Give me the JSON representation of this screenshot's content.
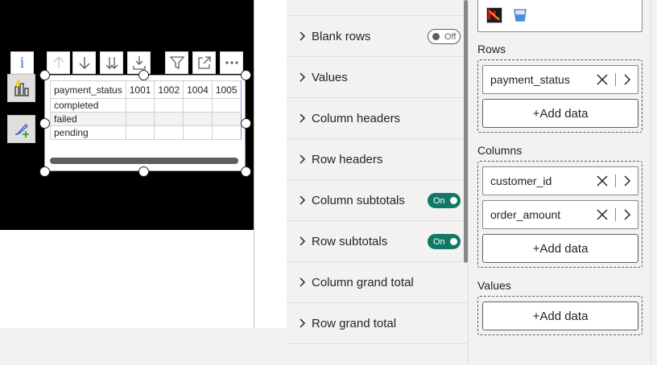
{
  "matrix": {
    "row_header_title": "payment_status",
    "columns": [
      "1001",
      "1002",
      "1004",
      "1005"
    ],
    "rows": [
      "completed",
      "failed",
      "pending"
    ]
  },
  "toolbar": {
    "info_glyph": "i"
  },
  "format_pane": {
    "items": [
      {
        "label": "Blank rows",
        "toggle": "Off"
      },
      {
        "label": "Values"
      },
      {
        "label": "Column headers"
      },
      {
        "label": "Row headers"
      },
      {
        "label": "Column subtotals",
        "toggle": "On"
      },
      {
        "label": "Row subtotals",
        "toggle": "On"
      },
      {
        "label": "Column grand total"
      },
      {
        "label": "Row grand total"
      }
    ]
  },
  "fields_pane": {
    "rows_label": "Rows",
    "rows_fields": [
      "payment_status"
    ],
    "columns_label": "Columns",
    "columns_fields": [
      "customer_id",
      "order_amount"
    ],
    "values_label": "Values",
    "add_data_label": "+Add data"
  },
  "colors": {
    "toggle_on": "#117865",
    "canvas_black": "#000000",
    "accent_highlight": "#8f8fe6"
  }
}
